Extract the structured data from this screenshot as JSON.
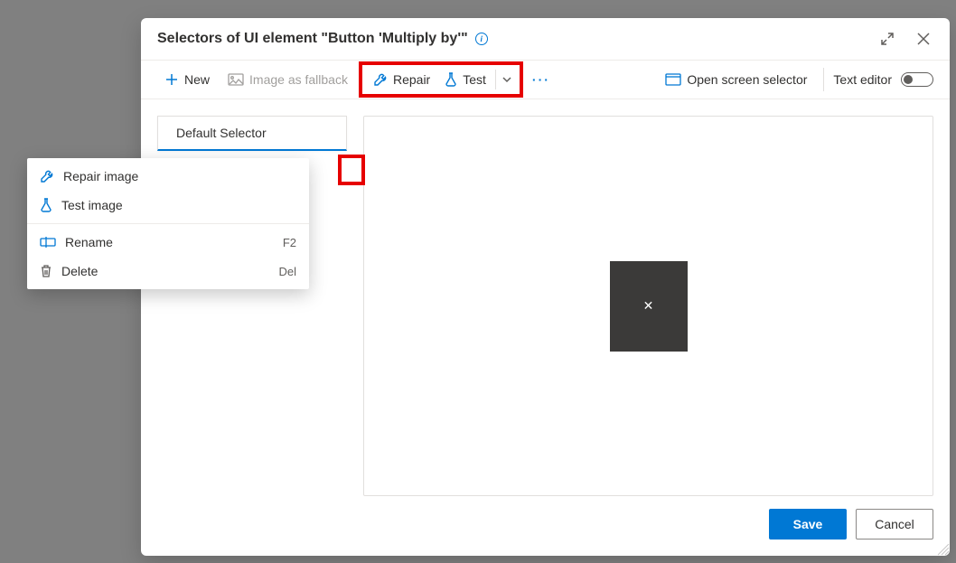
{
  "title": "Selectors of UI element \"Button 'Multiply by'\"",
  "toolbar": {
    "new": "New",
    "image_fallback": "Image as fallback",
    "repair": "Repair",
    "test": "Test",
    "open_selector": "Open screen selector",
    "text_editor": "Text editor"
  },
  "selector_item": "Default Selector",
  "thumb_glyph": "✕",
  "footer": {
    "save": "Save",
    "cancel": "Cancel"
  },
  "context_menu": {
    "repair_image": "Repair image",
    "test_image": "Test image",
    "rename": "Rename",
    "rename_shortcut": "F2",
    "delete": "Delete",
    "delete_shortcut": "Del"
  }
}
